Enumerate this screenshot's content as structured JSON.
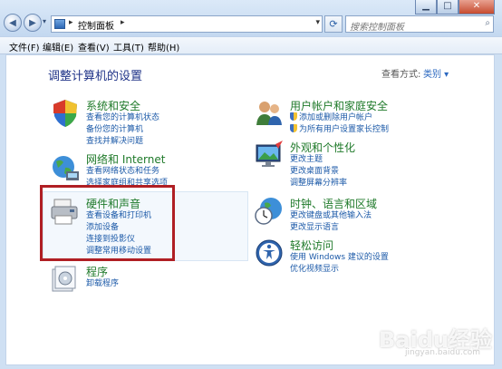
{
  "address": {
    "crumb": "控制面板",
    "chev1": "▸",
    "chev2": "▸",
    "dropdown": "▾"
  },
  "search": {
    "placeholder": "搜索控制面板"
  },
  "menu": [
    "文件(F)",
    "编辑(E)",
    "查看(V)",
    "工具(T)",
    "帮助(H)"
  ],
  "page_title": "调整计算机的设置",
  "view_by": {
    "label": "查看方式:",
    "value": "类别 ▾"
  },
  "categories": {
    "system_security": {
      "title": "系统和安全",
      "links": [
        "查看您的计算机状态",
        "备份您的计算机",
        "查找并解决问题"
      ]
    },
    "network": {
      "title": "网络和 Internet",
      "links": [
        "查看网络状态和任务",
        "选择家庭组和共享选项"
      ]
    },
    "hardware": {
      "title": "硬件和声音",
      "links": [
        "查看设备和打印机",
        "添加设备",
        "连接到投影仪",
        "调整常用移动设置"
      ]
    },
    "programs": {
      "title": "程序",
      "links": [
        "卸载程序"
      ]
    },
    "user_accounts": {
      "title": "用户帐户和家庭安全",
      "links": [
        "添加或删除用户帐户",
        "为所有用户设置家长控制"
      ]
    },
    "appearance": {
      "title": "外观和个性化",
      "links": [
        "更改主题",
        "更改桌面背景",
        "调整屏幕分辨率"
      ]
    },
    "clock": {
      "title": "时钟、语言和区域",
      "links": [
        "更改键盘或其他输入法",
        "更改显示语言"
      ]
    },
    "ease": {
      "title": "轻松访问",
      "links": [
        "使用 Windows 建议的设置",
        "优化视频显示"
      ]
    }
  },
  "watermark": {
    "main": "Baidu经验",
    "sub": "jingyan.baidu.com"
  },
  "colors": {
    "title": "#1e3287",
    "category": "#1f7a2a",
    "link": "#1c5aa8",
    "highlight_border": "#b01f24"
  }
}
